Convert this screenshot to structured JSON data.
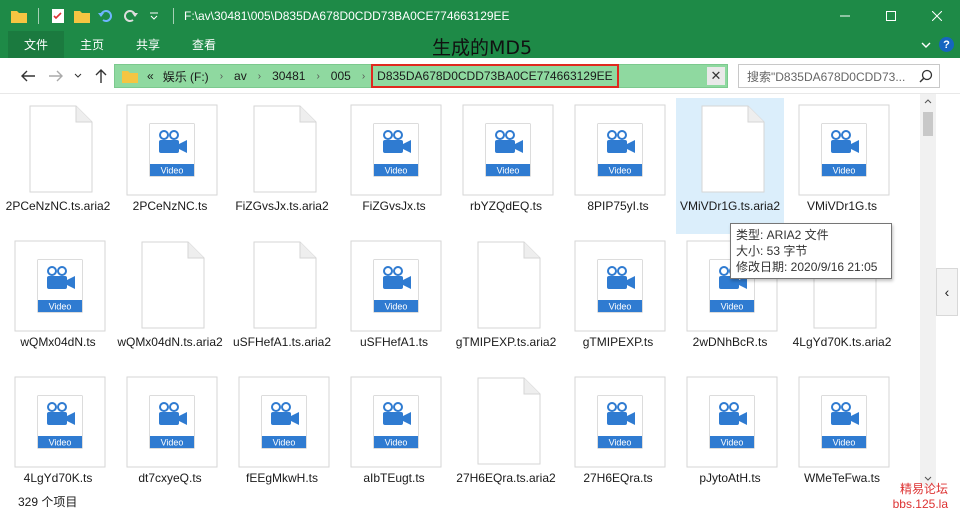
{
  "window": {
    "title": "F:\\av\\30481\\005\\D835DA678D0CDD73BA0CE774663129EE",
    "accent_color": "#1e8a47"
  },
  "ribbon": {
    "tabs": [
      "文件",
      "主页",
      "共享",
      "查看"
    ],
    "annotation": "生成的MD5"
  },
  "address": {
    "prefix": "«",
    "crumbs": [
      "娱乐 (F:)",
      "av",
      "30481",
      "005"
    ],
    "current": "D835DA678D0CDD73BA0CE774663129EE",
    "highlight_color": "#e0281f"
  },
  "search": {
    "placeholder": "搜索\"D835DA678D0CDD73..."
  },
  "files": [
    {
      "name": "2PCeNzNC.ts.aria2",
      "type": "doc"
    },
    {
      "name": "2PCeNzNC.ts",
      "type": "video"
    },
    {
      "name": "FiZGvsJx.ts.aria2",
      "type": "doc"
    },
    {
      "name": "FiZGvsJx.ts",
      "type": "video"
    },
    {
      "name": "rbYZQdEQ.ts",
      "type": "video"
    },
    {
      "name": "8PIP75yI.ts",
      "type": "video"
    },
    {
      "name": "VMiVDr1G.ts.aria2",
      "type": "doc",
      "selected": true
    },
    {
      "name": "VMiVDr1G.ts",
      "type": "video"
    },
    {
      "name": "wQMx04dN.ts",
      "type": "video"
    },
    {
      "name": "wQMx04dN.ts.aria2",
      "type": "doc"
    },
    {
      "name": "uSFHefA1.ts.aria2",
      "type": "doc"
    },
    {
      "name": "uSFHefA1.ts",
      "type": "video"
    },
    {
      "name": "gTMIPEXP.ts.aria2",
      "type": "doc"
    },
    {
      "name": "gTMIPEXP.ts",
      "type": "video"
    },
    {
      "name": "2wDNhBcR.ts",
      "type": "video"
    },
    {
      "name": "4LgYd70K.ts.aria2",
      "type": "doc"
    },
    {
      "name": "4LgYd70K.ts",
      "type": "video"
    },
    {
      "name": "dt7cxyeQ.ts",
      "type": "video"
    },
    {
      "name": "fEEgMkwH.ts",
      "type": "video"
    },
    {
      "name": "aIbTEugt.ts",
      "type": "video"
    },
    {
      "name": "27H6EQra.ts.aria2",
      "type": "doc"
    },
    {
      "name": "27H6EQra.ts",
      "type": "video"
    },
    {
      "name": "pJytoAtH.ts",
      "type": "video"
    },
    {
      "name": "WMeTeFwa.ts",
      "type": "video"
    }
  ],
  "video_badge": "Video",
  "tooltip": {
    "line1": "类型: ARIA2 文件",
    "line2": "大小: 53 字节",
    "line3": "修改日期: 2020/9/16 21:05"
  },
  "status": {
    "count": "329 个项目"
  },
  "watermark": {
    "line1": "精易论坛",
    "line2": "bbs.125.la"
  }
}
